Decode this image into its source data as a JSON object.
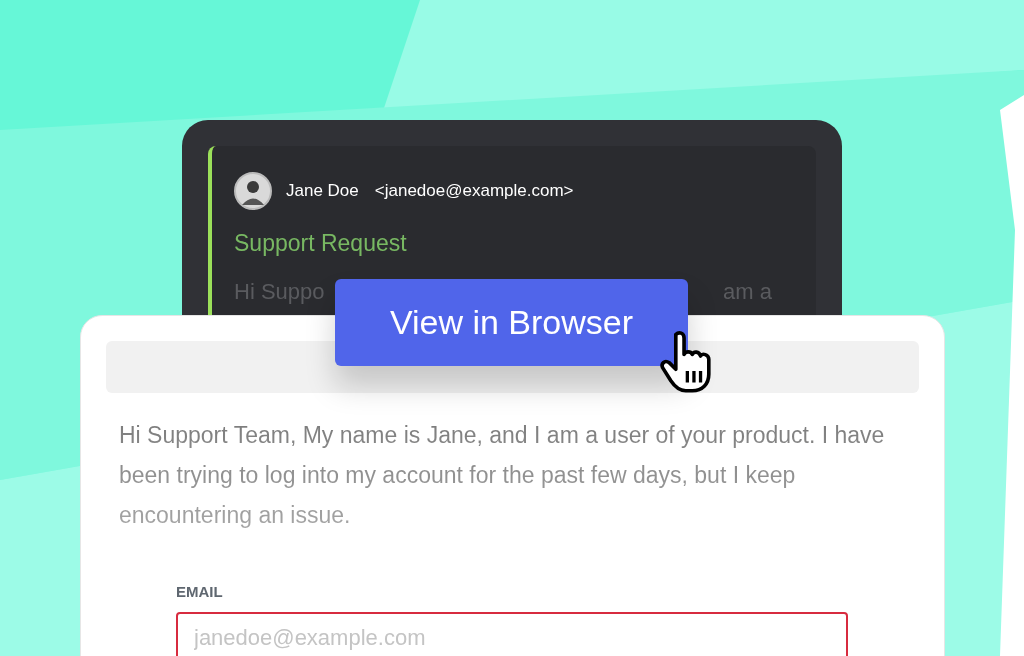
{
  "email_preview": {
    "sender_name": "Jane Doe",
    "sender_email": "<janedoe@example.com>",
    "subject": "Support Request",
    "snippet_start": "Hi Suppo",
    "snippet_end": "am a"
  },
  "view_button": {
    "label": "View in Browser"
  },
  "message": {
    "text": "Hi Support Team, My name is Jane, and I am a user of your product. I have been trying to log into my account for the past few days, but I keep encountering an issue."
  },
  "email_field": {
    "label": "EMAIL",
    "placeholder": "janedoe@example.com",
    "invalid": true
  }
}
